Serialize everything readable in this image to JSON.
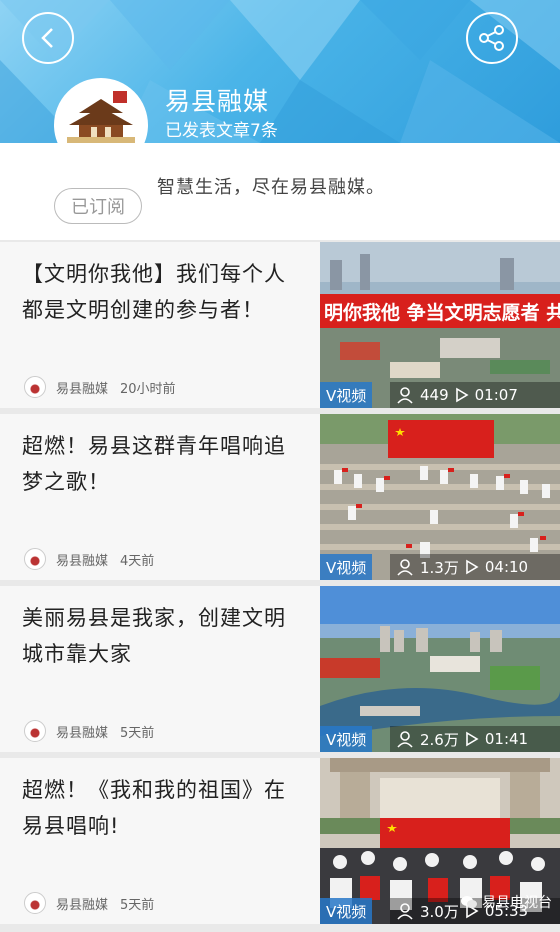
{
  "header": {
    "account_name": "易县融媒",
    "article_count_text": "已发表文章7条",
    "slogan": "智慧生活，尽在易县融媒。",
    "subscribe_label": "已订阅",
    "back_icon": "chevron-left-icon",
    "share_icon": "share-icon"
  },
  "articles": [
    {
      "title": "【文明你我他】我们每个人都是文明创建的参与者！",
      "source": "易县融媒",
      "time": "20小时前",
      "badge": "V视频",
      "views": "449",
      "duration": "01:07"
    },
    {
      "title": "超燃！易县这群青年唱响追梦之歌！",
      "source": "易县融媒",
      "time": "4天前",
      "badge": "V视频",
      "views": "1.3万",
      "duration": "04:10"
    },
    {
      "title": "美丽易县是我家，创建文明城市靠大家",
      "source": "易县融媒",
      "time": "5天前",
      "badge": "V视频",
      "views": "2.6万",
      "duration": "01:41"
    },
    {
      "title": "超燃！《我和我的祖国》在易县唱响!",
      "source": "易县融媒",
      "time": "5天前",
      "badge": "V视频",
      "views": "3.0万",
      "duration": "05:33"
    }
  ],
  "thumb_banner_text": "明你我他 争当文明志愿者 共建文明县",
  "watermark": "易县电视台",
  "colors": {
    "header_blue": "#4ab4e8",
    "badge_blue": "#2878c8",
    "flag_red": "#d8201c"
  }
}
